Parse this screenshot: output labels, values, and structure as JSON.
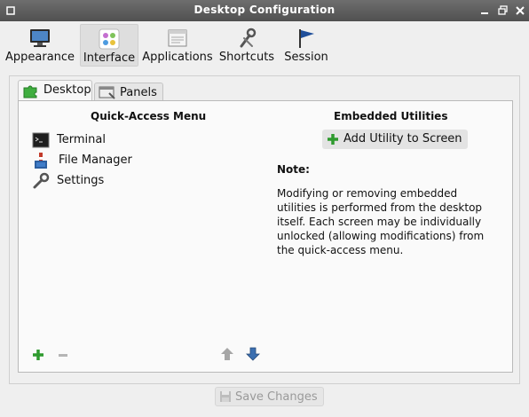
{
  "window": {
    "title": "Desktop Configuration"
  },
  "toolbar": {
    "items": [
      {
        "label": "Appearance",
        "icon": "monitor-icon"
      },
      {
        "label": "Interface",
        "icon": "interface-grid-icon",
        "active": true
      },
      {
        "label": "Applications",
        "icon": "applications-window-icon"
      },
      {
        "label": "Shortcuts",
        "icon": "tools-icon"
      },
      {
        "label": "Session",
        "icon": "flag-icon"
      }
    ]
  },
  "tabs": [
    {
      "label": "Desktop",
      "icon": "desktop-puzzle-icon",
      "active": true
    },
    {
      "label": "Panels",
      "icon": "panels-icon"
    }
  ],
  "quick_access": {
    "heading": "Quick-Access Menu",
    "items": [
      {
        "label": "Terminal",
        "icon": "terminal-icon"
      },
      {
        "label": "File Manager",
        "icon": "file-manager-icon"
      },
      {
        "label": "Settings",
        "icon": "wrench-icon"
      }
    ]
  },
  "embedded": {
    "heading": "Embedded Utilities",
    "add_button": "Add Utility to Screen",
    "note_title": "Note:",
    "note_body": "Modifying or removing embedded utilities is performed from the desktop itself. Each screen may be individually unlocked (allowing modifications) from the quick-access menu."
  },
  "footer": {
    "save_label": "Save Changes",
    "save_enabled": false
  },
  "colors": {
    "titlebar": "#5a5a5a",
    "add_green": "#2e9a2e",
    "arrow_blue": "#3b6fb0"
  }
}
